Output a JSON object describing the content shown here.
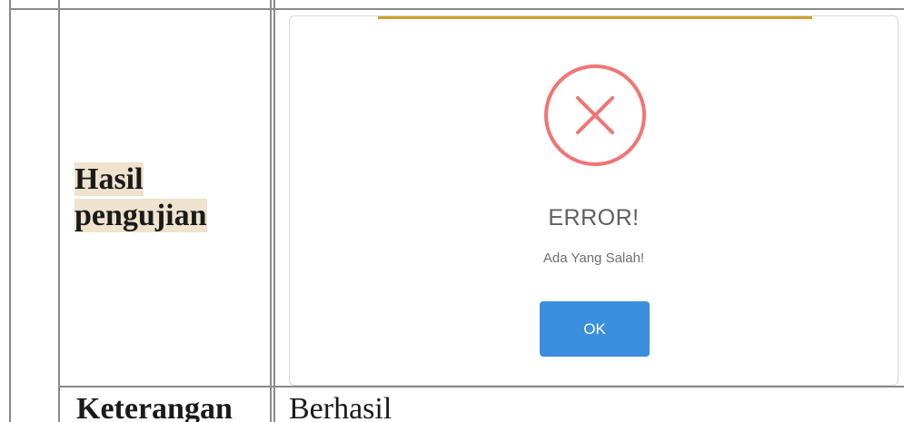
{
  "table": {
    "row_label": [
      "Hasil",
      "pengujian"
    ],
    "bottom_row": {
      "label": "Keterangan",
      "value": "Berhasil"
    }
  },
  "dialog": {
    "icon": "error-x-icon",
    "title": "ERROR!",
    "message": "Ada Yang Salah!",
    "ok_label": "OK",
    "colors": {
      "icon": "#f27474",
      "button": "#3b8fde",
      "accent_bar": "#c9a227",
      "label_highlight": "#efe3cf"
    }
  }
}
